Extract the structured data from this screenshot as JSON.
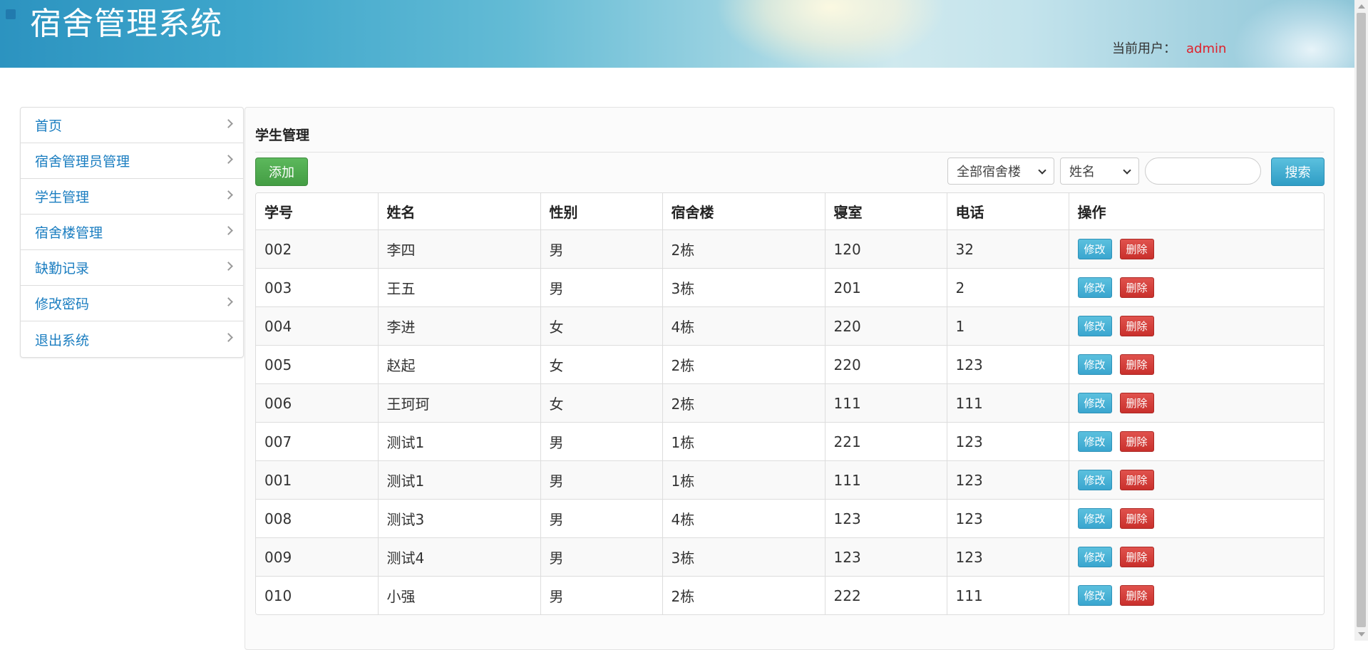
{
  "header": {
    "title": "宿舍管理系统",
    "current_user_label": "当前用户：",
    "current_user": "admin"
  },
  "sidebar": {
    "items": [
      {
        "label": "首页",
        "name": "home"
      },
      {
        "label": "宿舍管理员管理",
        "name": "dorm-admin-management"
      },
      {
        "label": "学生管理",
        "name": "student-management"
      },
      {
        "label": "宿舍楼管理",
        "name": "dorm-building-management"
      },
      {
        "label": "缺勤记录",
        "name": "absence-records"
      },
      {
        "label": "修改密码",
        "name": "change-password"
      },
      {
        "label": "退出系统",
        "name": "logout"
      }
    ]
  },
  "main": {
    "title": "学生管理",
    "add_label": "添加",
    "building_select": "全部宿舍楼",
    "field_select": "姓名",
    "search_value": "",
    "search_label": "搜索"
  },
  "table": {
    "columns": [
      "学号",
      "姓名",
      "性别",
      "宿舍楼",
      "寝室",
      "电话",
      "操作"
    ],
    "rows": [
      [
        "002",
        "李四",
        "男",
        "2栋",
        "120",
        "32"
      ],
      [
        "003",
        "王五",
        "男",
        "3栋",
        "201",
        "2"
      ],
      [
        "004",
        "李进",
        "女",
        "4栋",
        "220",
        "1"
      ],
      [
        "005",
        "赵起",
        "女",
        "2栋",
        "220",
        "123"
      ],
      [
        "006",
        "王珂珂",
        "女",
        "2栋",
        "111",
        "111"
      ],
      [
        "007",
        "测试1",
        "男",
        "1栋",
        "221",
        "123"
      ],
      [
        "001",
        "测试1",
        "男",
        "1栋",
        "111",
        "123"
      ],
      [
        "008",
        "测试3",
        "男",
        "4栋",
        "123",
        "123"
      ],
      [
        "009",
        "测试4",
        "男",
        "3栋",
        "123",
        "123"
      ],
      [
        "010",
        "小强",
        "男",
        "2栋",
        "222",
        "111"
      ]
    ],
    "edit_label": "修改",
    "delete_label": "删除"
  },
  "colors": {
    "link": "#1a7dc0",
    "add_button": "#5cb85c",
    "search_button": "#5bc0de",
    "edit_button": "#5bc0de",
    "delete_button": "#d9534f",
    "username": "#e0202a"
  }
}
